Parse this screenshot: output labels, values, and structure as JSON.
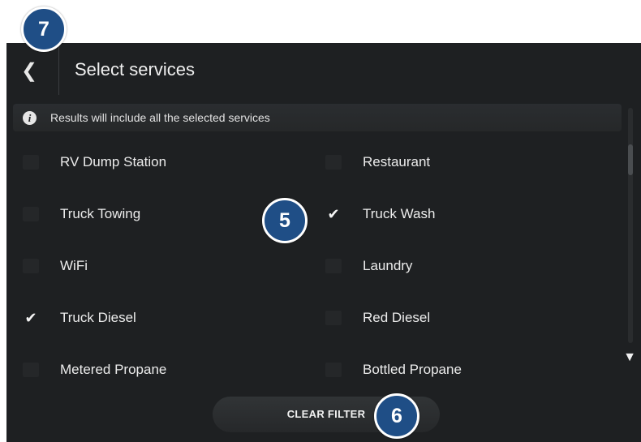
{
  "header": {
    "back_icon": "chevron-left-icon",
    "title": "Select services"
  },
  "info": {
    "icon": "info-icon",
    "text": "Results will include all the selected services"
  },
  "services": {
    "left": [
      {
        "label": "RV Dump Station",
        "checked": false
      },
      {
        "label": "Truck Towing",
        "checked": false
      },
      {
        "label": "WiFi",
        "checked": false
      },
      {
        "label": "Truck Diesel",
        "checked": true
      },
      {
        "label": "Metered Propane",
        "checked": false
      }
    ],
    "right": [
      {
        "label": "Restaurant",
        "checked": false
      },
      {
        "label": "Truck Wash",
        "checked": true
      },
      {
        "label": "Laundry",
        "checked": false
      },
      {
        "label": "Red Diesel",
        "checked": false
      },
      {
        "label": "Bottled Propane",
        "checked": false
      }
    ]
  },
  "check_glyph": "✔",
  "clear_filter_label": "CLEAR FILTER",
  "callouts": {
    "seven": "7",
    "five": "5",
    "six": "6"
  },
  "colors": {
    "background": "#1e2022",
    "callout": "#1f4e86",
    "text": "#ececec"
  }
}
